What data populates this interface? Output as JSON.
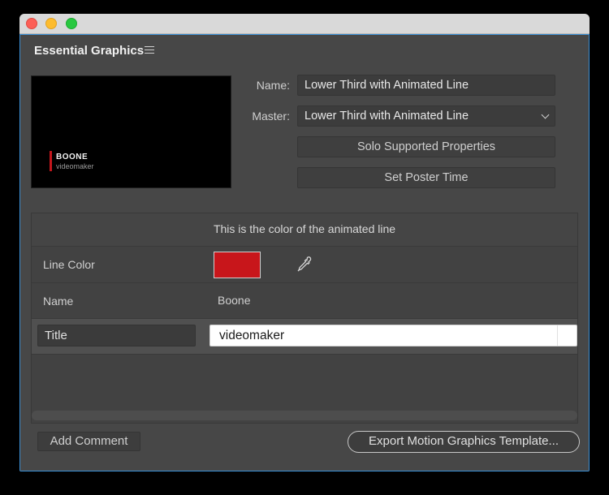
{
  "panel": {
    "title": "Essential Graphics"
  },
  "preview": {
    "name_text": "BOONE",
    "sub_text": "videomaker"
  },
  "fields": {
    "name_label": "Name:",
    "name_value": "Lower Third with Animated Line",
    "master_label": "Master:",
    "master_value": "Lower Third with Animated Line"
  },
  "buttons": {
    "solo_label": "Solo Supported Properties",
    "poster_label": "Set Poster Time",
    "add_comment_label": "Add Comment",
    "export_label": "Export Motion Graphics Template..."
  },
  "properties": {
    "description": "This is the color of the animated line",
    "line_color_label": "Line Color",
    "line_color_value": "#c8161b",
    "name_label": "Name",
    "name_value": "Boone",
    "title_label": "Title",
    "title_value": "videomaker"
  },
  "icons": {
    "panel_menu": "hamburger-menu-icon",
    "master_dropdown": "chevron-down-icon",
    "eyedropper": "eyedropper-icon"
  },
  "colors": {
    "accent_border": "#3a8fd6",
    "line_color": "#c8161b"
  }
}
